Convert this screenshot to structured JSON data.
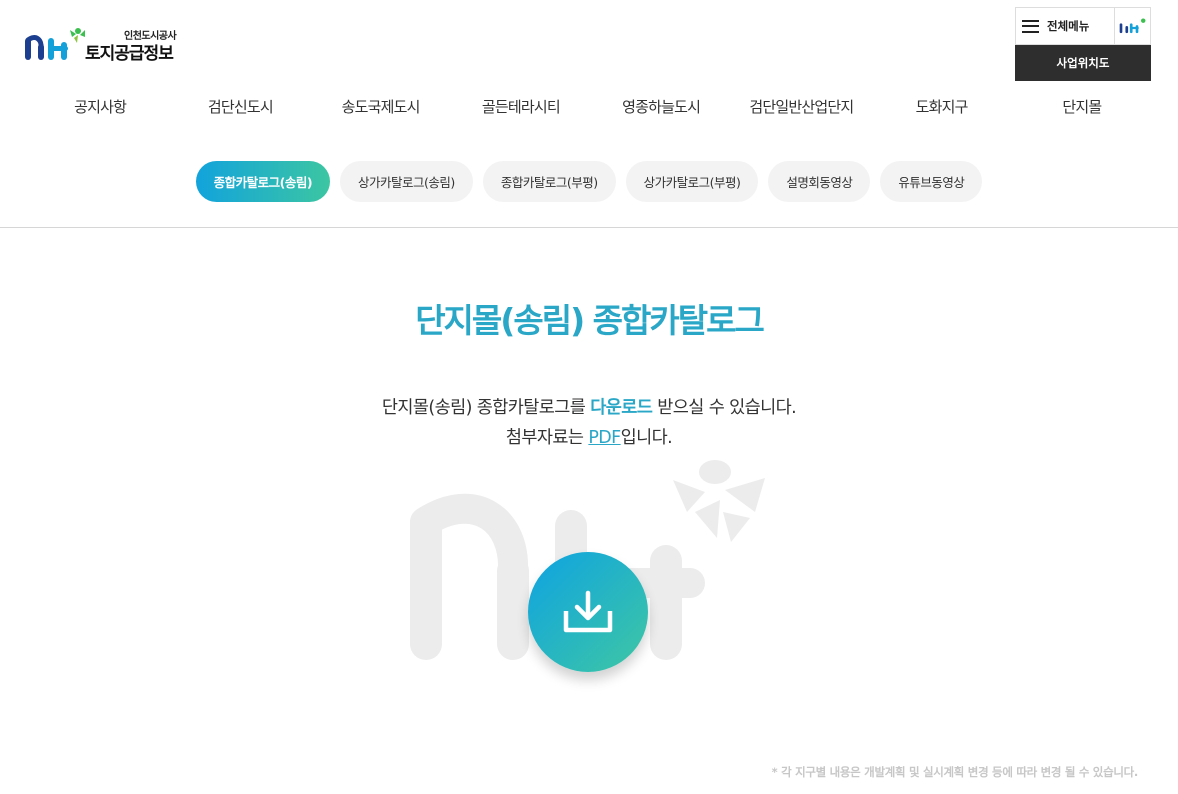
{
  "header": {
    "org_name": "인천도시공사",
    "site_name": "토지공급정보",
    "menu_label": "전체메뉴",
    "sitemap_label": "사업위치도"
  },
  "gnb": [
    {
      "label": "공지사항"
    },
    {
      "label": "검단신도시"
    },
    {
      "label": "송도국제도시"
    },
    {
      "label": "골든테라시티"
    },
    {
      "label": "영종하늘도시"
    },
    {
      "label": "검단일반산업단지"
    },
    {
      "label": "도화지구"
    },
    {
      "label": "단지몰"
    }
  ],
  "tabs": [
    {
      "label": "종합카탈로그(송림)",
      "active": true
    },
    {
      "label": "상가카탈로그(송림)",
      "active": false
    },
    {
      "label": "종합카탈로그(부평)",
      "active": false
    },
    {
      "label": "상가카탈로그(부평)",
      "active": false
    },
    {
      "label": "설명회동영상",
      "active": false
    },
    {
      "label": "유튜브동영상",
      "active": false
    }
  ],
  "main": {
    "title": "단지몰(송림) 종합카탈로그",
    "desc1_pre": "단지몰(송림) 종합카탈로그를 ",
    "desc1_hl": "다운로드",
    "desc1_post": " 받으실 수 있습니다.",
    "desc2_pre": "첨부자료는 ",
    "desc2_link": "PDF",
    "desc2_post": "입니다.",
    "download_icon": "download-icon"
  },
  "footer_note": "* 각 지구별 내용은 개발계획 및 실시계획 변경 등에 따라 변경 될 수 있습니다.",
  "colors": {
    "accent": "#2aa7c7",
    "gradient_start": "#12a3dc",
    "gradient_end": "#3cc6a2",
    "dark": "#2e2e2e"
  }
}
